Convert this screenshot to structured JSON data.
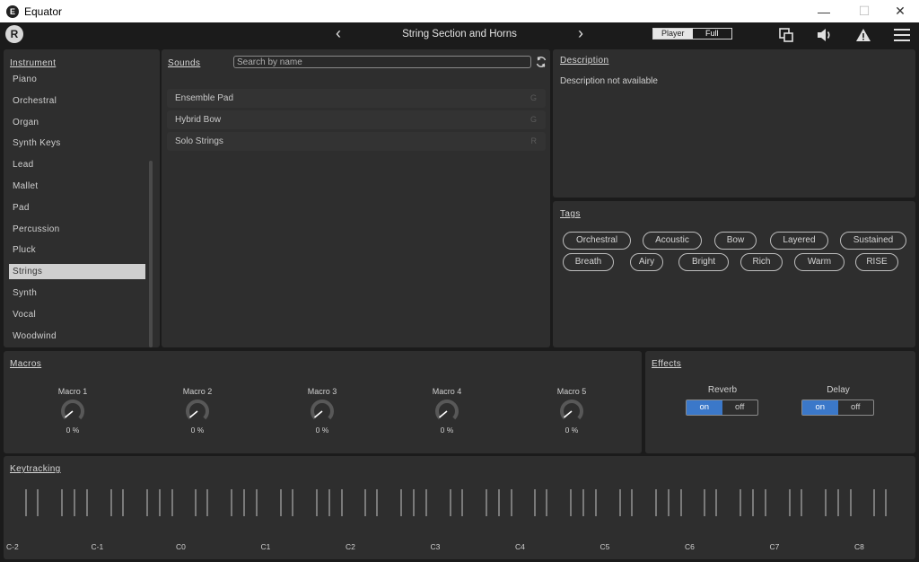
{
  "window": {
    "app_icon_letter": "E",
    "title": "Equator",
    "min": "—",
    "max": "☐",
    "close": "✕"
  },
  "header": {
    "logo_letter": "R",
    "prev": "‹",
    "next": "›",
    "preset_name": "String Section and Horns",
    "modes": [
      "Player",
      "Full"
    ],
    "active_mode": "Player"
  },
  "instrument": {
    "title": "Instrument",
    "items": [
      "Piano",
      "Orchestral",
      "Organ",
      "Synth Keys",
      "Lead",
      "Mallet",
      "Pad",
      "Percussion",
      "Pluck",
      "Strings",
      "Synth",
      "Vocal",
      "Woodwind"
    ],
    "selected": "Strings"
  },
  "sounds": {
    "title": "Sounds",
    "search_placeholder": "Search by name",
    "items": [
      {
        "name": "Ensemble Pad",
        "badge": "G"
      },
      {
        "name": "Hybrid Bow",
        "badge": "G"
      },
      {
        "name": "Solo Strings",
        "badge": "R"
      }
    ]
  },
  "description": {
    "title": "Description",
    "text": "Description not available"
  },
  "tags": {
    "title": "Tags",
    "items": [
      "Orchestral",
      "Acoustic",
      "Bow",
      "Layered",
      "Sustained",
      "Breath",
      "Airy",
      "Bright",
      "Rich",
      "Warm",
      "RISE"
    ]
  },
  "macros": {
    "title": "Macros",
    "items": [
      {
        "label": "Macro 1",
        "value": "0 %"
      },
      {
        "label": "Macro 2",
        "value": "0 %"
      },
      {
        "label": "Macro 3",
        "value": "0 %"
      },
      {
        "label": "Macro 4",
        "value": "0 %"
      },
      {
        "label": "Macro 5",
        "value": "0 %"
      }
    ]
  },
  "effects": {
    "title": "Effects",
    "on_label": "on",
    "off_label": "off",
    "items": [
      {
        "label": "Reverb",
        "state": "on"
      },
      {
        "label": "Delay",
        "state": "on"
      }
    ]
  },
  "keytracking": {
    "title": "Keytracking",
    "octaves": [
      "C-2",
      "C-1",
      "C0",
      "C1",
      "C2",
      "C3",
      "C4",
      "C5",
      "C6",
      "C7",
      "C8"
    ]
  },
  "colors": {
    "accent": "#3b78c9",
    "panel": "#2e2e2e",
    "background": "#1b1b1b"
  }
}
